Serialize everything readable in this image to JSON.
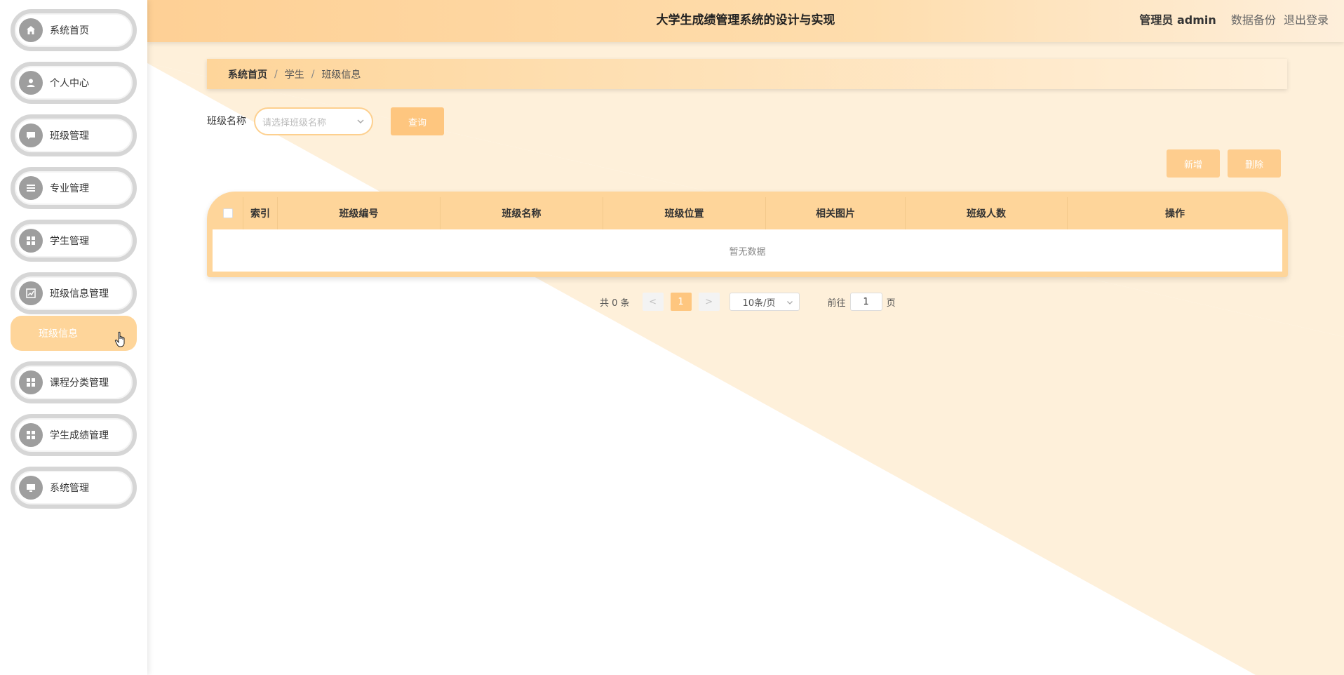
{
  "header": {
    "title": "大学生成绩管理系统的设计与实现",
    "user": "管理员 admin",
    "backup": "数据备份",
    "logout": "退出登录"
  },
  "sidebar": {
    "items": [
      {
        "label": "系统首页",
        "icon": "home-icon"
      },
      {
        "label": "个人中心",
        "icon": "user-icon"
      },
      {
        "label": "班级管理",
        "icon": "chat-icon"
      },
      {
        "label": "专业管理",
        "icon": "list-icon"
      },
      {
        "label": "学生管理",
        "icon": "grid-icon"
      },
      {
        "label": "班级信息管理",
        "icon": "chart-icon"
      },
      {
        "label": "课程分类管理",
        "icon": "grid-icon"
      },
      {
        "label": "学生成绩管理",
        "icon": "grid-icon"
      },
      {
        "label": "系统管理",
        "icon": "monitor-icon"
      }
    ],
    "submenu": "班级信息"
  },
  "breadcrumb": {
    "home": "系统首页",
    "sep": "/",
    "level1": "学生",
    "level2": "班级信息"
  },
  "search": {
    "label": "班级名称",
    "placeholder": "请选择班级名称",
    "query": "查询"
  },
  "actions": {
    "add": "新增",
    "delete": "删除"
  },
  "table": {
    "headers": [
      "索引",
      "班级编号",
      "班级名称",
      "班级位置",
      "相关图片",
      "班级人数",
      "操作"
    ],
    "empty": "暂无数据"
  },
  "pagination": {
    "total": "共 0 条",
    "prev": "<",
    "page": "1",
    "next": ">",
    "size": "10条/页",
    "goto": "前往",
    "goto_value": "1",
    "page_unit": "页"
  },
  "colors": {
    "accent": "#fec67f",
    "header": "#fed095",
    "background_triangle": "#fef0da"
  }
}
